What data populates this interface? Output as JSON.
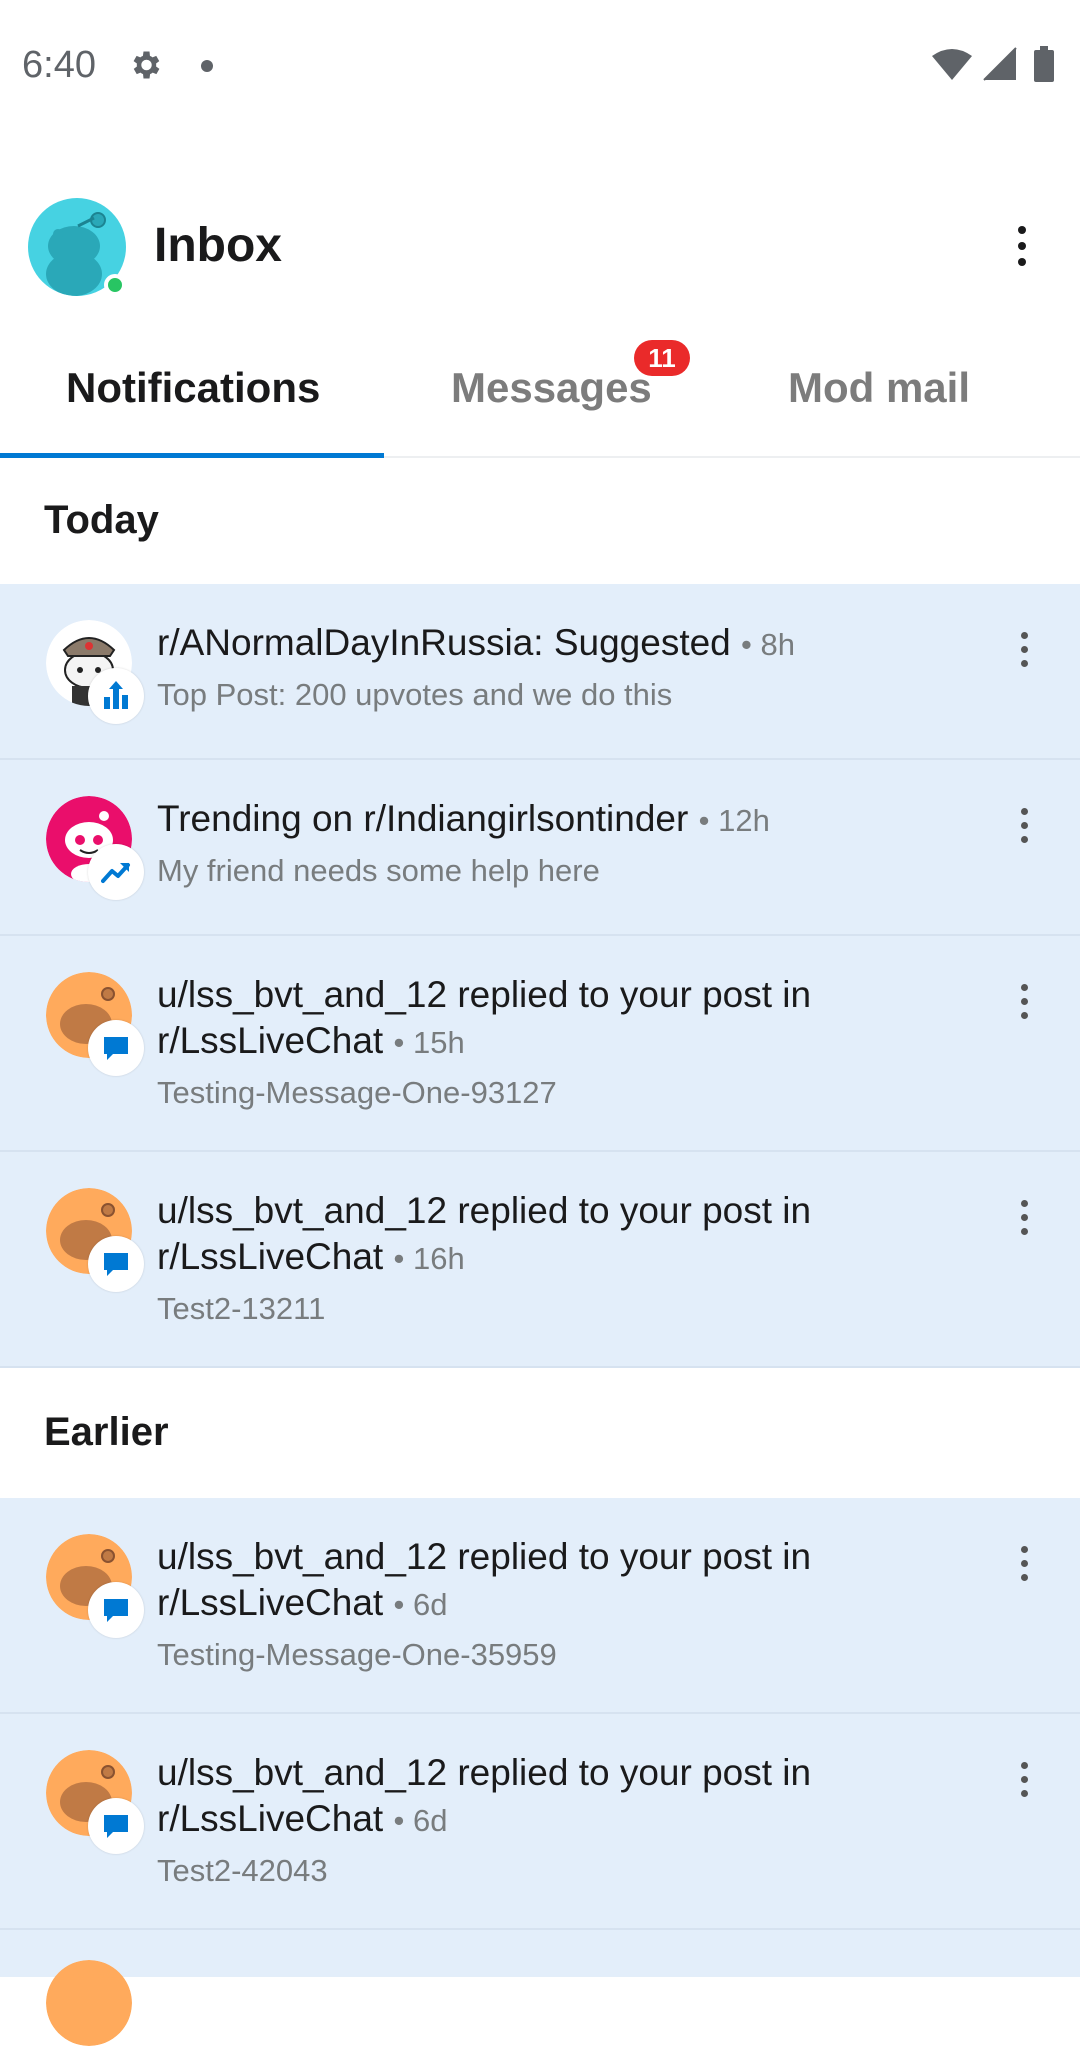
{
  "status_bar": {
    "time": "6:40"
  },
  "header": {
    "title": "Inbox"
  },
  "tabs": [
    {
      "label": "Notifications",
      "active": true
    },
    {
      "label": "Messages",
      "badge": "11"
    },
    {
      "label": "Mod mail"
    }
  ],
  "sections": {
    "today": "Today",
    "earlier": "Earlier"
  },
  "notifications": [
    {
      "title": "r/ANormalDayInRussia: Suggested",
      "time": "8h",
      "body": "Top Post: 200 upvotes and we do this",
      "icon": "upvote-icon"
    },
    {
      "title": "Trending on r/Indiangirlsontinder",
      "time": "12h",
      "body": "My friend needs some help here",
      "icon": "trending-icon"
    },
    {
      "title": "u/lss_bvt_and_12 replied to your post in r/LssLiveChat",
      "time": "15h",
      "body": "Testing-Message-One-93127",
      "icon": "comment-icon"
    },
    {
      "title": "u/lss_bvt_and_12 replied to your post in r/LssLiveChat",
      "time": "16h",
      "body": "Test2-13211",
      "icon": "comment-icon"
    },
    {
      "title": "u/lss_bvt_and_12 replied to your post in r/LssLiveChat",
      "time": "6d",
      "body": "Testing-Message-One-35959",
      "icon": "comment-icon"
    },
    {
      "title": "u/lss_bvt_and_12 replied to your post in r/LssLiveChat",
      "time": "6d",
      "body": "Test2-42043",
      "icon": "comment-icon"
    }
  ],
  "colors": {
    "accent": "#0079d3",
    "item_bg": "#e3eefa",
    "badge": "#ea2a2a",
    "online": "#28c563"
  }
}
